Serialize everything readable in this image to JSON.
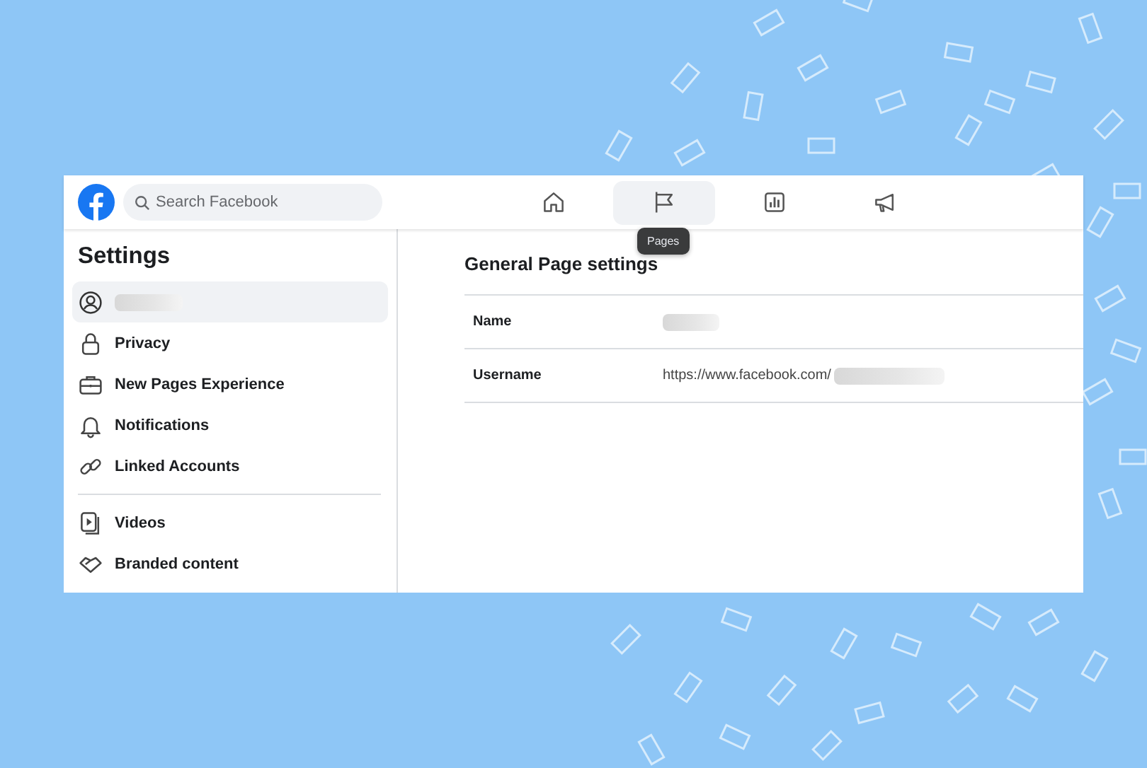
{
  "topbar": {
    "search": {
      "placeholder": "Search Facebook"
    },
    "nav": [
      {
        "kind": "home",
        "selected": false
      },
      {
        "kind": "flag",
        "selected": true,
        "tooltip": "Pages"
      },
      {
        "kind": "chart",
        "selected": false
      },
      {
        "kind": "megaphone",
        "selected": false
      }
    ]
  },
  "sidebar": {
    "title": "Settings",
    "groups": [
      [
        {
          "kind": "profile",
          "redacted": true,
          "selected": true
        },
        {
          "kind": "lock",
          "label": "Privacy",
          "selected": false
        },
        {
          "kind": "briefcase",
          "label": "New Pages Experience",
          "selected": false
        },
        {
          "kind": "bell",
          "label": "Notifications",
          "selected": false
        },
        {
          "kind": "link",
          "label": "Linked Accounts",
          "selected": false
        }
      ],
      [
        {
          "kind": "video",
          "label": "Videos",
          "selected": false
        },
        {
          "kind": "handshake",
          "label": "Branded content",
          "selected": false
        }
      ]
    ]
  },
  "main": {
    "title": "General Page settings",
    "rows": [
      {
        "label": "Name",
        "redacted": true
      },
      {
        "label": "Username",
        "value": "https://www.facebook.com/",
        "redacted": true
      }
    ]
  }
}
